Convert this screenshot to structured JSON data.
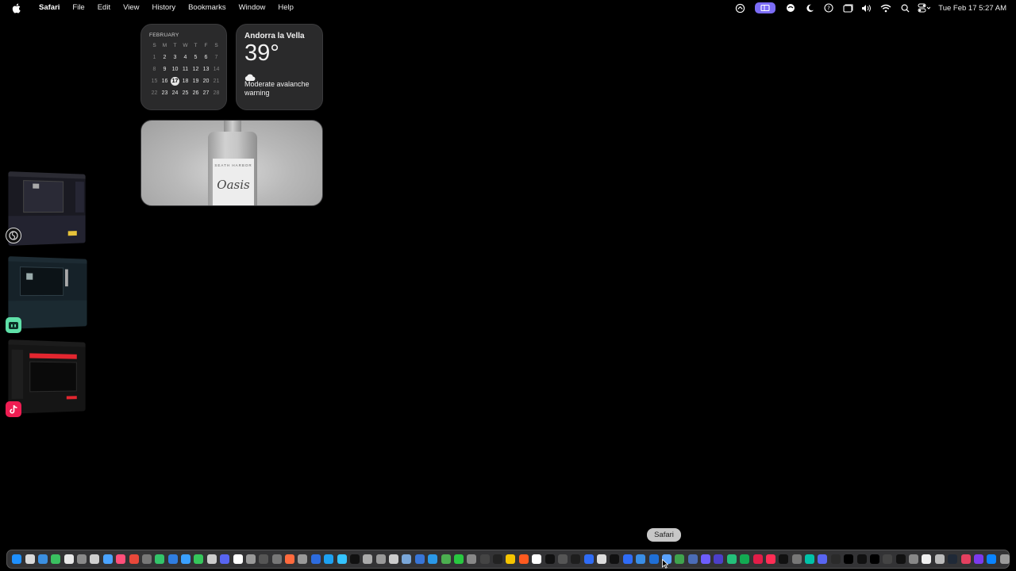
{
  "menubar": {
    "app_name": "Safari",
    "menus": [
      "File",
      "Edit",
      "View",
      "History",
      "Bookmarks",
      "Window",
      "Help"
    ],
    "status_icons": [
      "screen-mirroring-icon",
      "stage-manager-icon",
      "vpn-icon",
      "do-not-disturb-icon",
      "help-circle-icon",
      "window-icon",
      "volume-icon",
      "wifi-icon",
      "spotlight-search-icon",
      "control-center-icon"
    ],
    "clock": "Tue Feb 17  5:27 AM"
  },
  "calendar": {
    "month": "FEBRUARY",
    "weekdays": [
      "S",
      "M",
      "T",
      "W",
      "T",
      "F",
      "S"
    ],
    "weeks": [
      [
        "1",
        "2",
        "3",
        "4",
        "5",
        "6",
        "7"
      ],
      [
        "8",
        "9",
        "10",
        "11",
        "12",
        "13",
        "14"
      ],
      [
        "15",
        "16",
        "17",
        "18",
        "19",
        "20",
        "21"
      ],
      [
        "22",
        "23",
        "24",
        "25",
        "26",
        "27",
        "28"
      ]
    ],
    "today": "17"
  },
  "weather": {
    "city": "Andorra la Vella",
    "temperature": "39°",
    "condition_icon": "cloud-icon",
    "condition": "Moderate avalanche warning"
  },
  "photo": {
    "brand": "SEATH HARBOR",
    "product": "Oasis"
  },
  "stage_manager": [
    {
      "app": "OBS",
      "icon": "obs-icon"
    },
    {
      "app": "Streamlabs",
      "icon": "streamlabs-icon"
    },
    {
      "app": "TikTok",
      "icon": "tiktok-icon"
    }
  ],
  "dock": {
    "tooltip": "Safari",
    "colors": [
      "#1e90ff",
      "#d9d9d9",
      "#3b8fe0",
      "#3ac060",
      "#e8e8e8",
      "#8a8a8a",
      "#cfcfcf",
      "#4aa3ff",
      "#ff4f7a",
      "#e8483a",
      "#777",
      "#33c46a",
      "#2f7de1",
      "#3aa0ff",
      "#35c65b",
      "#ccc",
      "#5865f2",
      "#fff",
      "#999",
      "#555",
      "#777",
      "#ff6a3d",
      "#999",
      "#2d6cdf",
      "#1da1f2",
      "#34c3ff",
      "#111",
      "#aaa",
      "#999",
      "#ccc",
      "#7aa7d9",
      "#3875d7",
      "#2a98e8",
      "#4caf50",
      "#28c840",
      "#888",
      "#444",
      "#222",
      "#f5c400",
      "#ff5a1f",
      "#fff",
      "#111",
      "#555",
      "#1e1e1e",
      "#2f6cf6",
      "#ddd",
      "#111",
      "#2f6cf6",
      "#3a8ee6",
      "#1f6fd6",
      "#5aa2ff",
      "#3fa34d",
      "#4b6cb7",
      "#6d5dfc",
      "#4c3fc9",
      "#24c17b",
      "#13aa52",
      "#e11d48",
      "#ff2d55",
      "#111",
      "#777",
      "#00c2a8",
      "#5865f2",
      "#2a2a2a",
      "#000",
      "#111",
      "#000",
      "#444",
      "#111",
      "#888",
      "#f0f0f0",
      "#bbb",
      "#1f2937",
      "#e4405f",
      "#7c3aed",
      "#0a84ff",
      "#9a9a9a"
    ]
  }
}
